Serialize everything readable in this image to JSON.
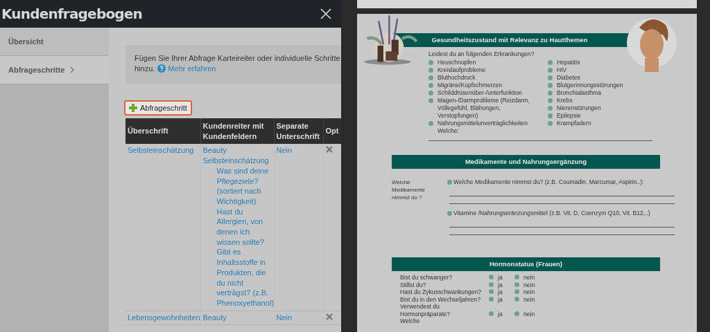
{
  "dialog": {
    "title": "Kundenfragebogen",
    "sidebar": [
      {
        "label": "Übersicht",
        "selected": false
      },
      {
        "label": "Abfrageschritte",
        "selected": true
      }
    ],
    "info": {
      "text": "Fügen Sie Ihrer Abfrage Karteireiter oder individuelle Schritte hinzu.",
      "link": "Mehr erfahren"
    },
    "add_button": "Abfrageschritt",
    "table": {
      "columns": [
        "Überschrift",
        "Kundenreiter mit Kundenfeldern",
        "Separate Unterschrift",
        "Opt"
      ],
      "rows": [
        {
          "heading": "Selbsteinschätzung",
          "group": "Beauty",
          "tab": "Selbsteinschätzung",
          "fields": [
            "Was sind deine Pflegeziele? (sortiert nach Wichtigkeit)",
            "Hast du Allergien, von denen ich wissen sollte?",
            "Gibt es Inhaltsstoffe in Produkten, die du nicht verträgst? (z.B. Phenoxyethanol)"
          ],
          "separate": "Nein"
        },
        {
          "heading": "Lebensgewohnheiten",
          "group": "Beauty",
          "fields": [],
          "separate": "Nein"
        }
      ]
    }
  },
  "document": {
    "sections": [
      {
        "kind": "checklist",
        "title": "Gesundheitszustand mit Relevanz zu Hautthemen",
        "prompt": "Leidest du an folgenden Erkrankungen?",
        "columns": [
          [
            "Heuschnupfen",
            "Kreislaufprobleme",
            "Bluthochdruck",
            "Migräne/Kopfschmerzen",
            "Schilddrüsenüber-/unterfunktion",
            "Magen-/Darmprobleme (Reizdarm, Völlegefühl, Blähungen, Verstopfungen)",
            "Nahrungsmittelunverträglichkeiten"
          ],
          [
            "Hepatitis",
            "HIV",
            "Diabetes",
            "Blutgerinnungsstörungen",
            "Bronchialasthma",
            "Krebs",
            "Nierenstörungen",
            "Epilepsie",
            "Krampfadern"
          ]
        ],
        "followup": "Welche:"
      },
      {
        "kind": "medication",
        "title": "Medikamente und Nahrungsergänzung",
        "side_label": "Welche Medikamente nimmst du ?",
        "items": [
          "Welche Medikamente nimmst du? (z.B. Coumadin, Marcumar, Aspirin..):",
          "Vitamine /Nahrungseränzungsmittel (z.B. Vit. D, Coenzym Q10, Vit. B12,..)"
        ]
      },
      {
        "kind": "yesno",
        "title": "Hormonstatus (Frauen)",
        "questions": [
          {
            "question": "Bist du schwanger?",
            "options": [
              "ja",
              "nein"
            ]
          },
          {
            "question": "Stillst du?",
            "options": [
              "ja",
              "nein"
            ]
          },
          {
            "question": "Hast du Zykusschwankungen?",
            "options": [
              "ja",
              "nein"
            ]
          },
          {
            "question": "Bist du in den Wechseljahren?",
            "options": [
              "ja",
              "nein"
            ]
          },
          {
            "question": "Verwendest du Hormonpräparate?",
            "options": [
              "ja",
              "nein"
            ]
          }
        ],
        "followup": "Welche"
      }
    ]
  }
}
